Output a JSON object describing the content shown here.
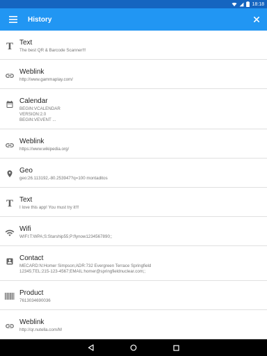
{
  "status_bar": {
    "time": "18:18"
  },
  "app_bar": {
    "title": "History"
  },
  "icons": {
    "menu": "menu-icon",
    "close": "close-icon",
    "text": "text-type-icon",
    "link": "link-icon",
    "calendar": "calendar-icon",
    "geo": "location-pin-icon",
    "wifi": "wifi-icon",
    "contact": "contact-card-icon",
    "product": "barcode-icon"
  },
  "colors": {
    "app_bar": "#2196f3",
    "status_bar": "#1565c0",
    "nav_bar": "#000000"
  },
  "history": [
    {
      "type": "Text",
      "value": "The best QR & Barcode Scanner!!!"
    },
    {
      "type": "Weblink",
      "value": "http://www.gammaplay.com/"
    },
    {
      "type": "Calendar",
      "value": "BEGIN:VCALENDAR\nVERSION:2.0\nBEGIN:VEVENT ..."
    },
    {
      "type": "Weblink",
      "value": "https://www.wikipedia.org/"
    },
    {
      "type": "Geo",
      "value": "geo:26.113192,-80.253947?q=100 montaditos"
    },
    {
      "type": "Text",
      "value": "I love this app! You must try it!!!"
    },
    {
      "type": "Wifi",
      "value": "WIFI:T:WPA;S:Starship55;P:flynow1234567890;;"
    },
    {
      "type": "Contact",
      "value": "MECARD:N:Homer Simpson;ADR:732 Evergreen Terrace Springfield\n12345;TEL:215-123-4567;EMAIL:homer@springfieldnuclear.com;;"
    },
    {
      "type": "Product",
      "value": "7613034690036"
    },
    {
      "type": "Weblink",
      "value": "http://qr.nutella.com/M"
    }
  ]
}
